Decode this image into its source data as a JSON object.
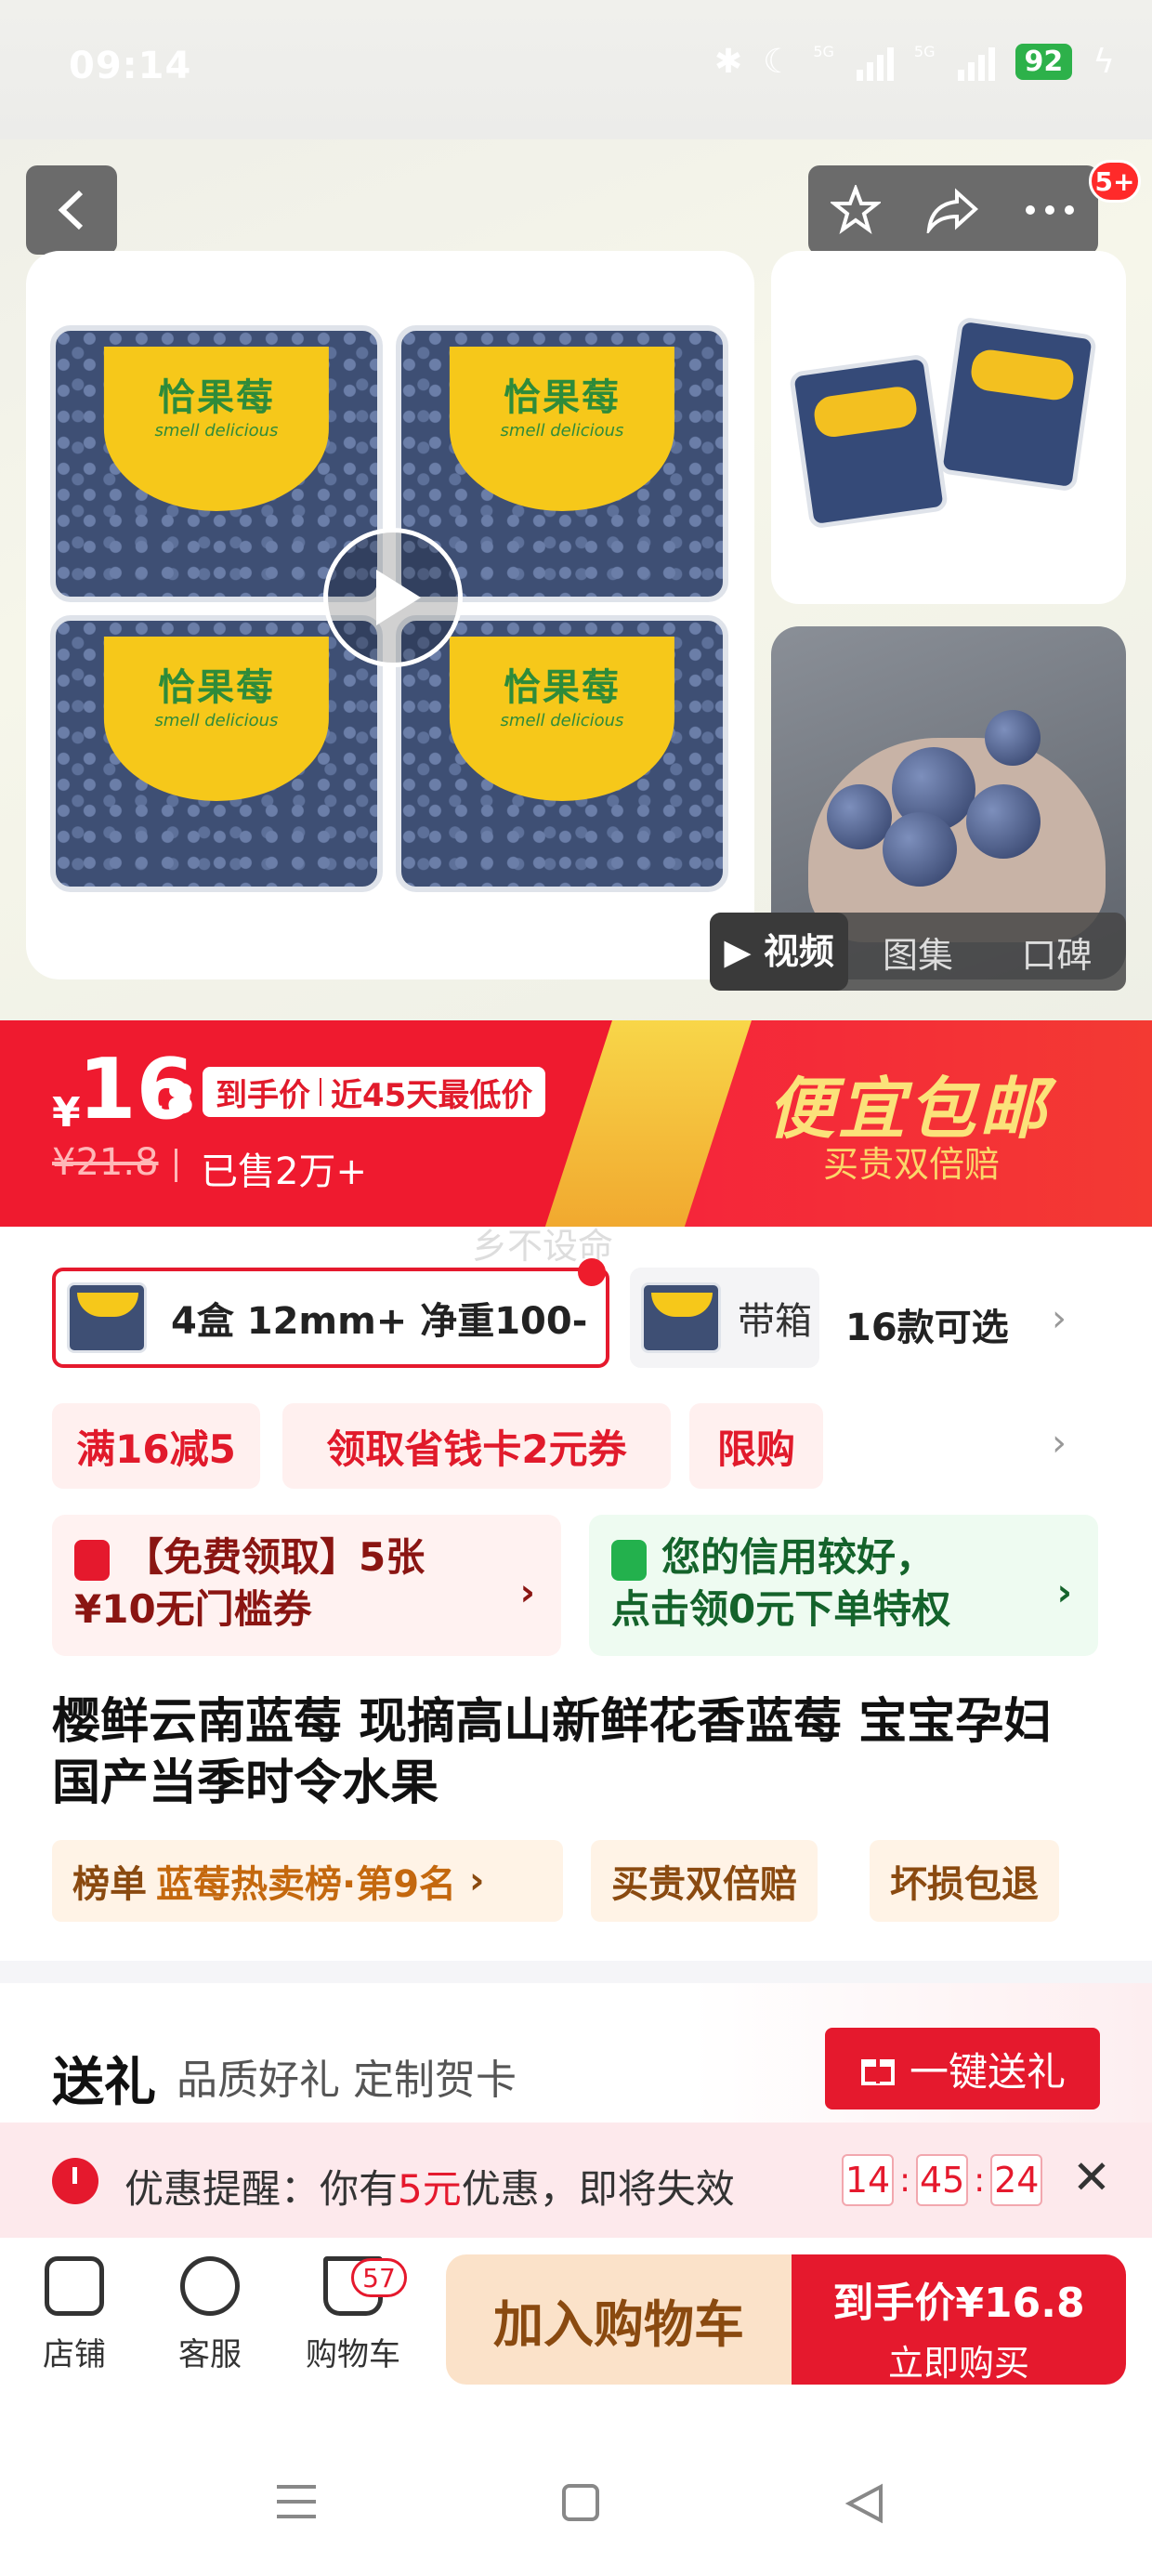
{
  "status": {
    "time": "09:14",
    "network_1": "5G",
    "network_2": "5G",
    "battery": "92"
  },
  "header": {
    "notification_badge": "5+"
  },
  "product_image": {
    "label_cn": "恰果莓",
    "label_en": "smell delicious"
  },
  "media_tabs": [
    "视频",
    "图集",
    "口碑"
  ],
  "price": {
    "currency": "¥",
    "integer": "16",
    "decimal": ".8",
    "tag_main": "到手价",
    "tag_sub": "近45天最低价",
    "original": "¥21.8",
    "sold": "已售2万+",
    "promo_title": "便宜包邮",
    "promo_sub": "买贵双倍赔",
    "watermark": "乡不设命"
  },
  "sku": {
    "selected": "4盒 12mm+ 净重100-",
    "other": "带箱",
    "count": "16款可选"
  },
  "coupons": {
    "chips": [
      "满16减5",
      "领取省钱卡2元券",
      "限购"
    ],
    "card_red_line1": "【免费领取】5张",
    "card_red_line2": "¥10无门槛券",
    "card_green_line1": "您的信用较好，",
    "card_green_line2": "点击领0元下单特权"
  },
  "title": "樱鲜云南蓝莓 现摘高山新鲜花香蓝莓 宝宝孕妇 国产当季时令水果",
  "tags": {
    "rank_label": "榜单",
    "rank_value": "蓝莓热卖榜·第9名",
    "double": "买贵双倍赔",
    "refund": "坏损包退"
  },
  "gift": {
    "title": "送礼",
    "sub": "品质好礼 定制贺卡",
    "button": "一键送礼"
  },
  "reminder": {
    "prefix": "优惠提醒：你有",
    "amount": "5元",
    "suffix": "优惠，即将失效",
    "h": "14",
    "m": "45",
    "s": "24"
  },
  "bottom": {
    "shop": "店铺",
    "service": "客服",
    "cart": "购物车",
    "cart_count": "57",
    "add_cart": "加入购物车",
    "buy_top": "到手价¥16.8",
    "buy_sub": "立即购买"
  },
  "colors": {
    "accent": "#e5192d",
    "promo_yellow": "#fbe27a"
  }
}
